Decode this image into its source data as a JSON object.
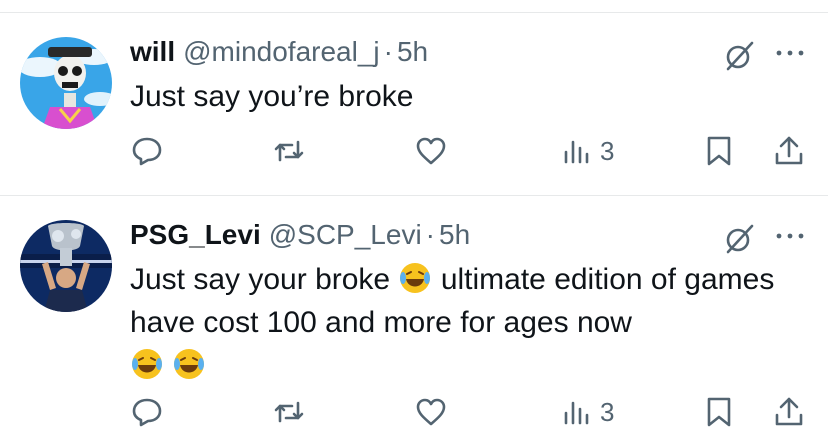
{
  "tweets": [
    {
      "name": "will",
      "handle": "@mindofareal_j",
      "separator": "·",
      "time": "5h",
      "text": "Just say you’re broke",
      "actions": {
        "reply_icon": "reply-icon",
        "repost_icon": "repost-icon",
        "like_icon": "heart-icon",
        "views_icon": "views-icon",
        "views_count": "3",
        "bookmark_icon": "bookmark-icon",
        "share_icon": "share-icon"
      }
    },
    {
      "name": "PSG_Levi",
      "handle": "@SCP_Levi",
      "separator": "·",
      "time": "5h",
      "text_part1": "Just say your broke",
      "text_part2": "ultimate edition of games have cost 100 and more for ages now",
      "actions": {
        "views_count": "3"
      }
    }
  ],
  "colors": {
    "text_primary": "#0f1419",
    "text_secondary": "#536471",
    "divider": "#e7e9ea"
  },
  "icons": [
    "grok-icon",
    "more-icon",
    "reply-icon",
    "repost-icon",
    "heart-icon",
    "views-icon",
    "bookmark-icon",
    "share-icon",
    "laughing-crying-emoji"
  ]
}
